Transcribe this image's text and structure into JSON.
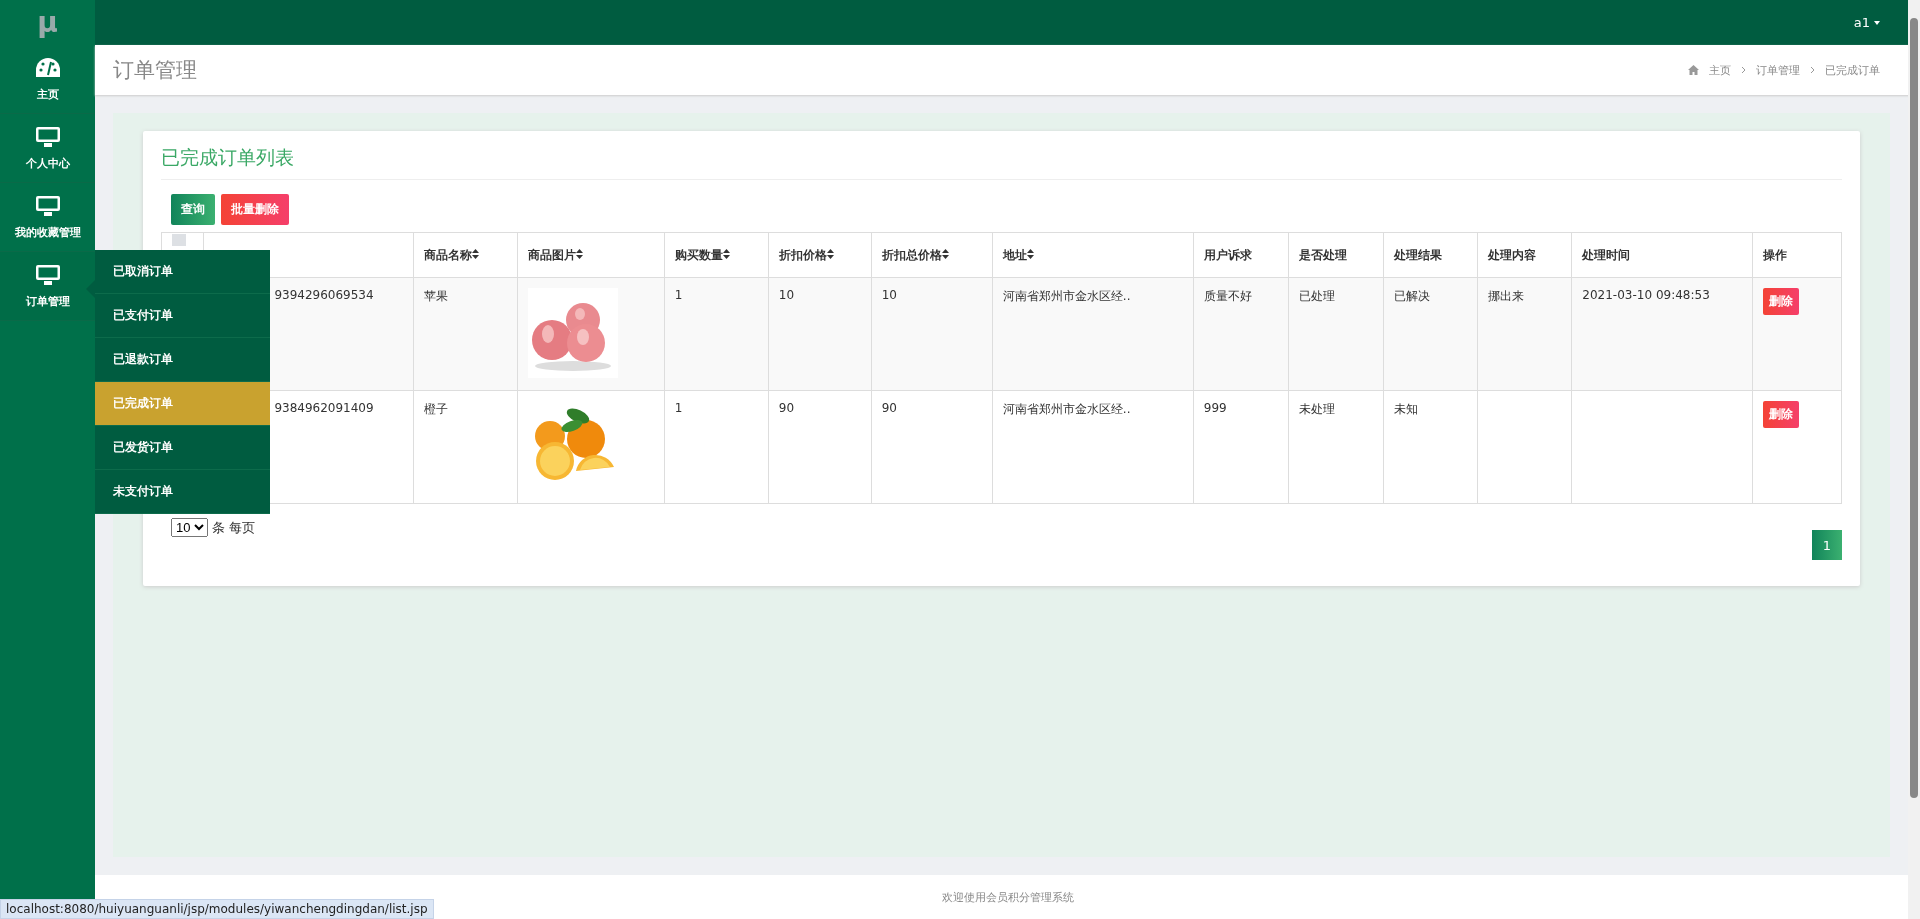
{
  "logo": "μ",
  "user_menu": {
    "label": "a1"
  },
  "sidebar": {
    "items": [
      {
        "label": "主页",
        "selected": false
      },
      {
        "label": "个人中心",
        "selected": false
      },
      {
        "label": "我的收藏管理",
        "selected": false
      },
      {
        "label": "订单管理",
        "selected": true
      }
    ]
  },
  "submenu": {
    "items": [
      {
        "label": "已取消订单",
        "selected": false
      },
      {
        "label": "已支付订单",
        "selected": false
      },
      {
        "label": "已退款订单",
        "selected": false
      },
      {
        "label": "已完成订单",
        "selected": true
      },
      {
        "label": "已发货订单",
        "selected": false
      },
      {
        "label": "未支付订单",
        "selected": false
      }
    ]
  },
  "page_title": "订单管理",
  "breadcrumb": [
    "主页",
    "订单管理",
    "已完成订单"
  ],
  "card": {
    "title": "已完成订单列表",
    "buttons": [
      {
        "label": "查询",
        "kind": "primary"
      },
      {
        "label": "批量删除",
        "kind": "danger"
      }
    ],
    "table": {
      "select_all_checked": false,
      "columns": [
        {
          "label": "商品名称",
          "sortable": true
        },
        {
          "label": "商品图片",
          "sortable": true
        },
        {
          "label": "购买数量",
          "sortable": true
        },
        {
          "label": "折扣价格",
          "sortable": true
        },
        {
          "label": "折扣总价格",
          "sortable": true
        },
        {
          "label": "地址",
          "sortable": true
        },
        {
          "label": "用户诉求",
          "sortable": false
        },
        {
          "label": "是否处理",
          "sortable": false
        },
        {
          "label": "处理结果",
          "sortable": false
        },
        {
          "label": "处理内容",
          "sortable": false
        },
        {
          "label": "处理时间",
          "sortable": false
        },
        {
          "label": "操作",
          "sortable": false
        }
      ],
      "rows": [
        {
          "order_no": "9394296069534",
          "name": "苹果",
          "quantity": "1",
          "price": "10",
          "total": "10",
          "address": "河南省郑州市金水区经..",
          "request": "质量不好",
          "handled": "已处理",
          "result": "已解决",
          "content": "挪出来",
          "time": "2021-03-10 09:48:53",
          "action": "删除"
        },
        {
          "order_no": "9384962091409",
          "name": "橙子",
          "quantity": "1",
          "price": "90",
          "total": "90",
          "address": "河南省郑州市金水区经..",
          "request": "999",
          "handled": "未处理",
          "result": "未知",
          "action": "删除"
        }
      ]
    },
    "page_size": {
      "value": "10",
      "suffix": "条 每页"
    },
    "pages": [
      {
        "label": "1",
        "selected": true
      }
    ]
  },
  "footer": "欢迎使用会员积分管理系统",
  "status_url": "localhost:8080/huiyuanguanli/jsp/modules/yiwanchengdingdan/list.jsp"
}
